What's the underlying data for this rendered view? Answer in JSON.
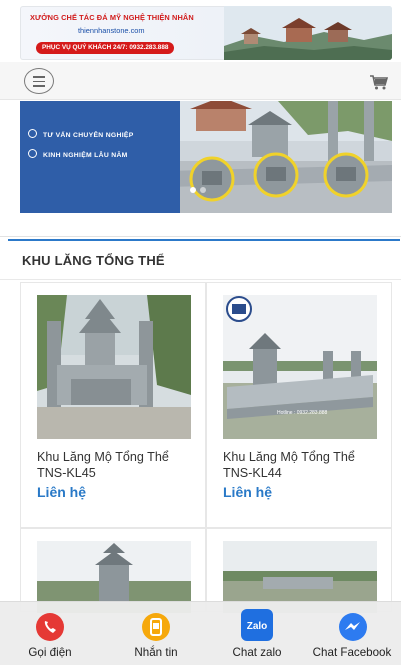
{
  "banner": {
    "line1": "XƯỞNG CHẾ TÁC ĐÁ MỸ NGHỆ THIỆN NHÂN",
    "line2": "thiennhanstone.com",
    "phone": "PHỤC VỤ QUÝ KHÁCH 24/7: 0932.283.888"
  },
  "header": {
    "menu_icon": "menu-icon",
    "cart_icon": "cart-icon"
  },
  "hero": {
    "lines": [
      "TƯ VẤN CHUYÊN NGHIỆP",
      "KINH NGHIỆM LÂU NĂM"
    ],
    "colors": {
      "panel": "#2f5ea8"
    }
  },
  "section": {
    "title": "KHU LĂNG TỔNG THỂ"
  },
  "products": [
    {
      "title": "Khu Lăng Mộ Tổng Thể TNS-KL45",
      "price": "Liên hệ"
    },
    {
      "title": "Khu Lăng Mộ Tổng Thể TNS-KL44",
      "price": "Liên hệ",
      "watermark": "Hotline : 0932.283.888"
    },
    {
      "title": "",
      "price": ""
    },
    {
      "title": "",
      "price": ""
    }
  ],
  "bottom_bar": [
    {
      "label": "Gọi điện",
      "icon": "phone-icon",
      "color": "#e53935"
    },
    {
      "label": "Nhắn tin",
      "icon": "sms-icon",
      "color": "#f6a80b"
    },
    {
      "label": "Chat zalo",
      "icon": "zalo-icon",
      "color": "#1f6fe0",
      "icon_text": "Zalo"
    },
    {
      "label": "Chat Facebook",
      "icon": "messenger-icon",
      "color": "#2d7bf0"
    }
  ],
  "colors": {
    "accent": "#2979c7",
    "hotline_red": "#d51a1a"
  }
}
